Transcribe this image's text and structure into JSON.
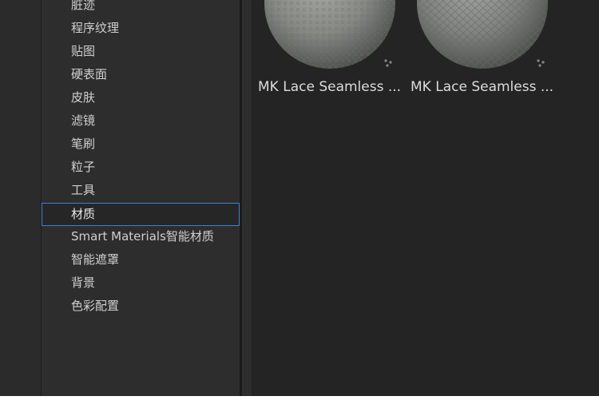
{
  "tree": {
    "items": [
      {
        "label": "脏迹"
      },
      {
        "label": "程序纹理"
      },
      {
        "label": "贴图"
      },
      {
        "label": "硬表面"
      },
      {
        "label": "皮肤"
      },
      {
        "label": "滤镜"
      },
      {
        "label": "笔刷"
      },
      {
        "label": "粒子"
      },
      {
        "label": "工具"
      },
      {
        "label": "材质",
        "selected": true
      },
      {
        "label": "Smart Materials智能材质"
      },
      {
        "label": "智能遮罩"
      },
      {
        "label": "背景"
      },
      {
        "label": "色彩配置"
      }
    ]
  },
  "assets": [
    {
      "label": "MK Lace Seamless ...",
      "icon": "sphere-thumbnail-icon"
    },
    {
      "label": "MK Lace Seamless ...",
      "icon": "sphere-thumbnail-icon"
    }
  ],
  "colors": {
    "selection_border": "#3d7fd6",
    "panel_bg": "#2d2d2d",
    "grid_bg": "#242424"
  }
}
